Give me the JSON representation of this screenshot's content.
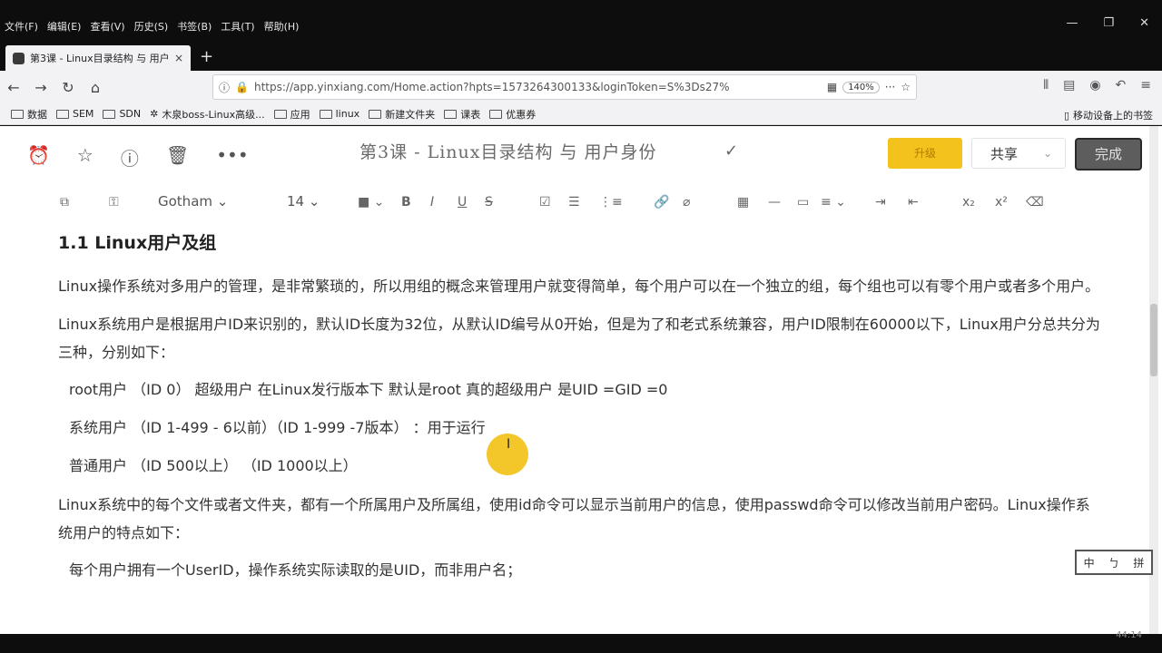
{
  "menubar": [
    "文件(F)",
    "编辑(E)",
    "查看(V)",
    "历史(S)",
    "书签(B)",
    "工具(T)",
    "帮助(H)"
  ],
  "window_controls": [
    "—",
    "❐",
    "✕"
  ],
  "tab": {
    "label": "第3课 - Linux目录结构 与 用户",
    "close": "×",
    "new_tab": "+"
  },
  "nav": {
    "url": "https://app.yinxiang.com/Home.action?hpts=1573264300133&loginToken=S%3Ds27%",
    "zoom": "140%"
  },
  "bookmarks": [
    "数据",
    "SEM",
    "SDN",
    "木泉boss-Linux高级...",
    "应用",
    "linux",
    "新建文件夹",
    "课表",
    "优惠券"
  ],
  "bookmark_mobile": "移动设备上的书签",
  "note": {
    "title": "第3课 - Linux目录结构 与 用户身份",
    "upgrade": "升级",
    "share": "共享",
    "done": "完成",
    "font": "Gotham",
    "font_size": "14"
  },
  "content": {
    "heading": "1.1 Linux用户及组",
    "p1": "Linux操作系统对多用户的管理，是非常繁琐的，所以用组的概念来管理用户就变得简单，每个用户可以在一个独立的组，每个组也可以有零个用户或者多个用户。",
    "p2": "Linux系统用户是根据用户ID来识别的，默认ID长度为32位，从默认ID编号从0开始，但是为了和老式系统兼容，用户ID限制在60000以下，Linux用户分总共分为三种，分别如下：",
    "li1": "root用户  （ID 0）    超级用户 在Linux发行版本下 默认是root   真的超级用户 是UID =GID =0",
    "li2": "系统用户  （ID 1-499   - 6以前）（ID 1-999   -7版本）   ：用于运行",
    "li3": "普通用户  （ID 500以上）  （ID 1000以上）",
    "p3": "Linux系统中的每个文件或者文件夹，都有一个所属用户及所属组，使用id命令可以显示当前用户的信息，使用passwd命令可以修改当前用户密码。Linux操作系统用户的特点如下：",
    "li4": "每个用户拥有一个UserID，操作系统实际读取的是UID，而非用户名；"
  },
  "ime": [
    "中",
    "ㄅ",
    "拼"
  ],
  "clock": "44:14"
}
